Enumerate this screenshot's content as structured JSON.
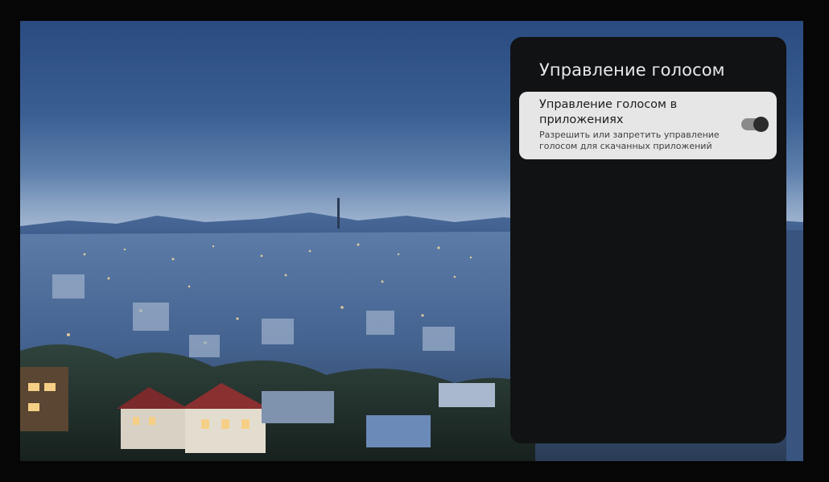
{
  "panel": {
    "title": "Управление голосом",
    "setting": {
      "title": "Управление голосом в приложениях",
      "description": "Разрешить или запретить управление голосом для скачанных приложений",
      "toggle_state": "on"
    }
  },
  "colors": {
    "panel_bg": "#111214",
    "row_bg": "#e6e6e6",
    "toggle_track": "#8a8a8a",
    "toggle_knob": "#2c2c2c"
  }
}
